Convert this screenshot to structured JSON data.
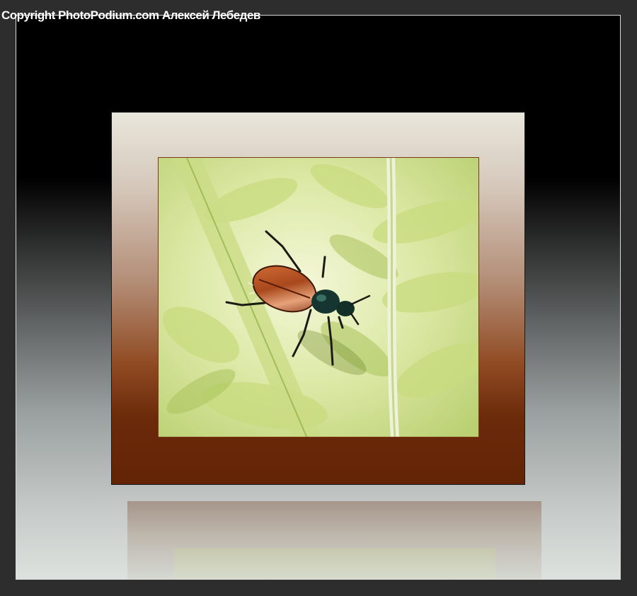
{
  "watermark": {
    "text": "Copyright PhotoPodium.com Алексей Лебедев"
  },
  "photo": {
    "subject": "beetle-on-fern"
  }
}
